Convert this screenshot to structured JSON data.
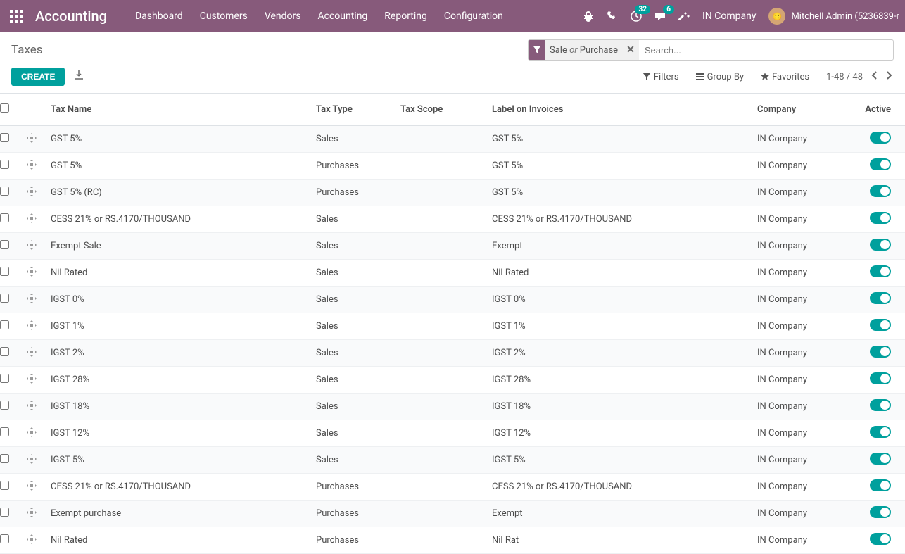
{
  "navbar": {
    "brand": "Accounting",
    "menu": [
      "Dashboard",
      "Customers",
      "Vendors",
      "Accounting",
      "Reporting",
      "Configuration"
    ],
    "clock_badge": "32",
    "chat_badge": "6",
    "company": "IN Company",
    "user": "Mitchell Admin (5236839-r"
  },
  "breadcrumb": "Taxes",
  "search": {
    "facet_label": "Sale or Purchase",
    "placeholder": "Search..."
  },
  "buttons": {
    "create": "CREATE",
    "filters": "Filters",
    "groupby": "Group By",
    "favorites": "Favorites"
  },
  "pager": "1-48 / 48",
  "columns": {
    "tax_name": "Tax Name",
    "tax_type": "Tax Type",
    "tax_scope": "Tax Scope",
    "label": "Label on Invoices",
    "company": "Company",
    "active": "Active"
  },
  "rows": [
    {
      "name": "GST 5%",
      "type": "Sales",
      "scope": "",
      "label": "GST 5%",
      "company": "IN Company",
      "active": true
    },
    {
      "name": "GST 5%",
      "type": "Purchases",
      "scope": "",
      "label": "GST 5%",
      "company": "IN Company",
      "active": true
    },
    {
      "name": "GST 5% (RC)",
      "type": "Purchases",
      "scope": "",
      "label": "GST 5%",
      "company": "IN Company",
      "active": true
    },
    {
      "name": "CESS 21% or RS.4170/THOUSAND",
      "type": "Sales",
      "scope": "",
      "label": "CESS 21% or RS.4170/THOUSAND",
      "company": "IN Company",
      "active": true
    },
    {
      "name": "Exempt Sale",
      "type": "Sales",
      "scope": "",
      "label": "Exempt",
      "company": "IN Company",
      "active": true
    },
    {
      "name": "Nil Rated",
      "type": "Sales",
      "scope": "",
      "label": "Nil Rated",
      "company": "IN Company",
      "active": true
    },
    {
      "name": "IGST 0%",
      "type": "Sales",
      "scope": "",
      "label": "IGST 0%",
      "company": "IN Company",
      "active": true
    },
    {
      "name": "IGST 1%",
      "type": "Sales",
      "scope": "",
      "label": "IGST 1%",
      "company": "IN Company",
      "active": true
    },
    {
      "name": "IGST 2%",
      "type": "Sales",
      "scope": "",
      "label": "IGST 2%",
      "company": "IN Company",
      "active": true
    },
    {
      "name": "IGST 28%",
      "type": "Sales",
      "scope": "",
      "label": "IGST 28%",
      "company": "IN Company",
      "active": true
    },
    {
      "name": "IGST 18%",
      "type": "Sales",
      "scope": "",
      "label": "IGST 18%",
      "company": "IN Company",
      "active": true
    },
    {
      "name": "IGST 12%",
      "type": "Sales",
      "scope": "",
      "label": "IGST 12%",
      "company": "IN Company",
      "active": true
    },
    {
      "name": "IGST 5%",
      "type": "Sales",
      "scope": "",
      "label": "IGST 5%",
      "company": "IN Company",
      "active": true
    },
    {
      "name": "CESS 21% or RS.4170/THOUSAND",
      "type": "Purchases",
      "scope": "",
      "label": "CESS 21% or RS.4170/THOUSAND",
      "company": "IN Company",
      "active": true
    },
    {
      "name": "Exempt purchase",
      "type": "Purchases",
      "scope": "",
      "label": "Exempt",
      "company": "IN Company",
      "active": true
    },
    {
      "name": "Nil Rated",
      "type": "Purchases",
      "scope": "",
      "label": "Nil Rat",
      "company": "IN Company",
      "active": true
    }
  ]
}
